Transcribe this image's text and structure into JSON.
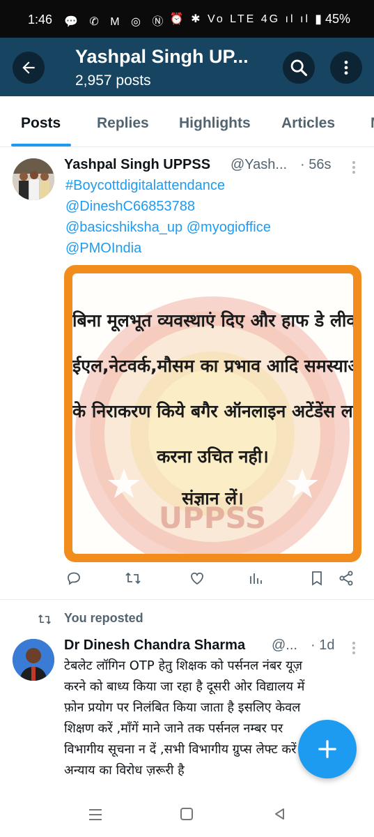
{
  "status_bar": {
    "time": "1:46",
    "left_icons": "💬 ✆ M ◎ Ⓝ •",
    "right_icons": "⏰ ✱ Vo LTE 4G ıl ıl",
    "battery": "45%"
  },
  "header": {
    "title": "Yashpal Singh UP...",
    "subtitle": "2,957 posts"
  },
  "tabs": [
    {
      "label": "Posts",
      "active": true
    },
    {
      "label": "Replies",
      "active": false
    },
    {
      "label": "Highlights",
      "active": false
    },
    {
      "label": "Articles",
      "active": false
    },
    {
      "label": "M",
      "active": false
    }
  ],
  "post1": {
    "author": "Yashpal Singh UPPSS",
    "handle": "@Yash...",
    "time": "· 56s",
    "links": [
      "#Boycottdigitalattendance",
      "@DineshC66853788",
      "@basicshiksha_up @myogioffice",
      "@PMOIndia"
    ],
    "image_text": [
      "बिना मूलभूत व्यवस्थाएं दिए और हाफ डे लीव,",
      "ईएल,नेटवर्क,मौसम का प्रभाव आदि समस्याओं",
      "के निराकरण किये बगैर ऑनलाइन अटेंडेंस लागू",
      "करना उचित नही।",
      "संज्ञान लें।"
    ],
    "watermark_text": "UPPSS"
  },
  "repost_indicator": "You reposted",
  "post2": {
    "author": "Dr Dinesh Chandra Sharma",
    "handle": "@...",
    "time": "· 1d",
    "lines": [
      "टेबलेट लॉगिन OTP हेतु शिक्षक को पर्सनल नंबर यूज़",
      "करने को बाध्य किया जा रहा है दूसरी ओर विद्यालय में",
      "फ़ोन प्रयोग पर निलंबित किया जाता है इसलिए केवल",
      "शिक्षण करें ,माँगें माने जाने तक पर्सनल नम्बर पर",
      "विभागीय सूचना न दें ,सभी विभागीय ग्रुप्स लेफ्ट करें",
      "अन्याय का विरोध ज़रूरी है"
    ]
  },
  "fab_label": "+",
  "colors": {
    "accent": "#1d9bf0",
    "header_bg": "#174460",
    "image_border": "#f28c1c"
  },
  "icons": [
    "back-arrow-icon",
    "search-icon",
    "more-vertical-icon",
    "reply-icon",
    "repost-icon",
    "like-icon",
    "views-icon",
    "bookmark-icon",
    "share-icon",
    "plus-icon"
  ]
}
